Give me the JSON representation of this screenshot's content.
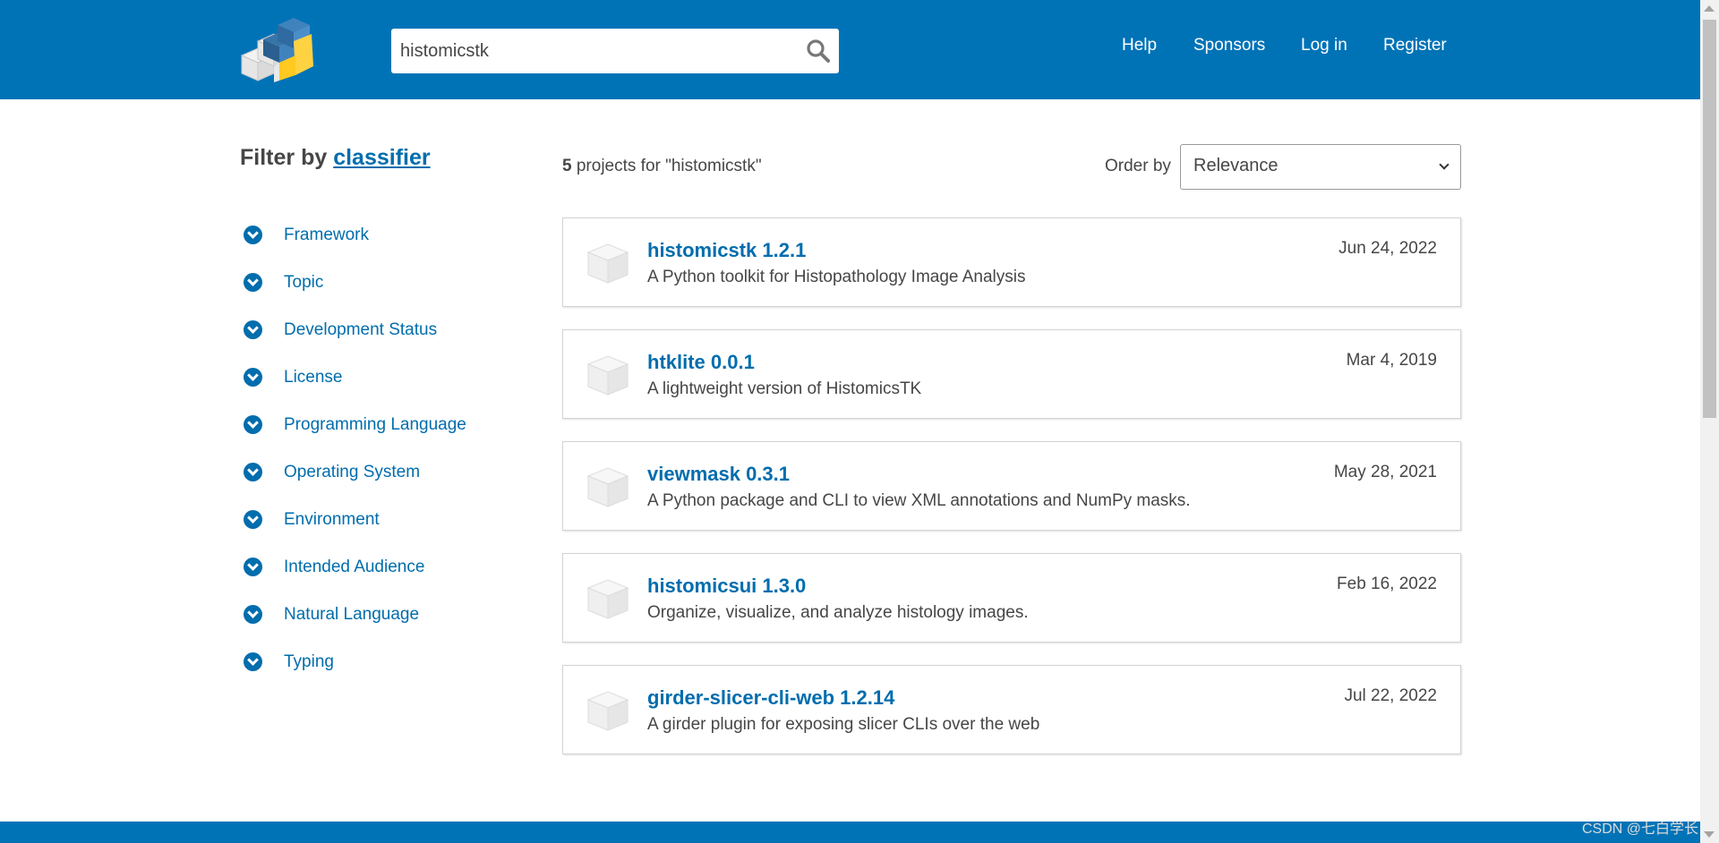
{
  "search": {
    "value": "histomicstk"
  },
  "nav": {
    "help": "Help",
    "sponsors": "Sponsors",
    "login": "Log in",
    "register": "Register"
  },
  "sidebar": {
    "title_prefix": "Filter by",
    "title_link": "classifier",
    "classifiers": [
      "Framework",
      "Topic",
      "Development Status",
      "License",
      "Programming Language",
      "Operating System",
      "Environment",
      "Intended Audience",
      "Natural Language",
      "Typing"
    ]
  },
  "results": {
    "count": "5",
    "count_suffix": " projects for \"histomicstk\"",
    "order_label": "Order by",
    "order_value": "Relevance",
    "packages": [
      {
        "name": "histomicstk 1.2.1",
        "description": "A Python toolkit for Histopathology Image Analysis",
        "date": "Jun 24, 2022"
      },
      {
        "name": "htklite 0.0.1",
        "description": "A lightweight version of HistomicsTK",
        "date": "Mar 4, 2019"
      },
      {
        "name": "viewmask 0.3.1",
        "description": "A Python package and CLI to view XML annotations and NumPy masks.",
        "date": "May 28, 2021"
      },
      {
        "name": "histomicsui 1.3.0",
        "description": "Organize, visualize, and analyze histology images.",
        "date": "Feb 16, 2022"
      },
      {
        "name": "girder-slicer-cli-web 1.2.14",
        "description": "A girder plugin for exposing slicer CLIs over the web",
        "date": "Jul 22, 2022"
      }
    ]
  },
  "watermark": "CSDN @七白学长",
  "colors": {
    "header": "#0073b7",
    "link": "#006dad",
    "logo_yellow": "#ffd242"
  },
  "icons": {
    "search": "search-icon",
    "classifier": "chevron-down-circle-icon",
    "package": "cube-icon",
    "logo": "pypi-logo"
  }
}
